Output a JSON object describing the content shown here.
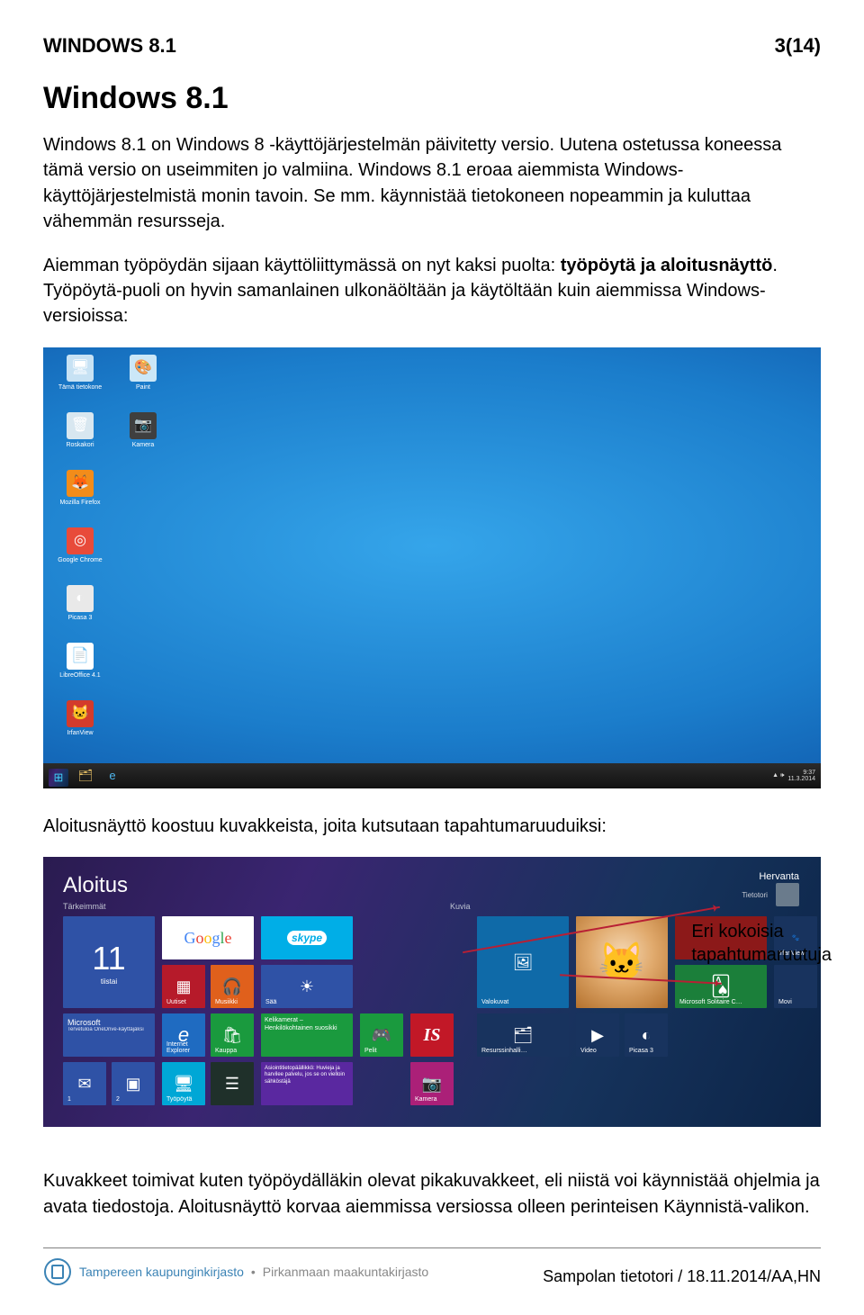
{
  "header": {
    "left": "WINDOWS 8.1",
    "right": "3(14)"
  },
  "title": "Windows 8.1",
  "para1_a": "Windows 8.1 on Windows 8 -käyttöjärjestelmän päivitetty versio. Uutena ostetussa koneessa tämä versio on useimmiten jo valmiina. Windows 8.1 eroaa aiemmista Windows-käyttöjärjestelmistä monin tavoin. Se mm. käynnistää tietokoneen nopeammin ja kuluttaa vähemmän resursseja.",
  "para2_a": "Aiemman työpöydän sijaan käyttöliittymässä on nyt kaksi puolta: ",
  "para2_bold": "työpöytä ja aloitusnäyttö",
  "para2_b": ". Työpöytä-puoli on hyvin samanlainen ulkonäöltään ja käytöltään kuin aiemmissa Windows-versioissa:",
  "para3": "Aloitusnäyttö koostuu kuvakkeista, joita kutsutaan tapahtumaruuduiksi:",
  "annotation": "Eri kokoisia\ntapahtumaruutuja",
  "para4": "Kuvakkeet toimivat kuten työpöydälläkin olevat pikakuvakkeet, eli niistä voi käynistää ohjelmia ja avata tiedostoja. Aloitusnäyttö korvaa aiemmissa versiossa olleen perinteisen Käynnistä-valikon.",
  "para4_fix": "Kuvakkeet toimivat kuten työpöydälläkin olevat pikakuvakkeet, eli niistä voi käynnistää ohjelmia ja avata tiedostoja. Aloitusnäyttö korvaa aiemmissa versiossa olleen perinteisen Käynnistä-valikon.",
  "desktop_icons": [
    {
      "label": "Tämä tietokone",
      "glyph": "🖥",
      "bg": "#c7e2f4"
    },
    {
      "label": "Paint",
      "glyph": "🎨",
      "bg": "#cbe7f7"
    },
    {
      "label": "Roskakori",
      "glyph": "🗑",
      "bg": "#d8e7f0"
    },
    {
      "label": "Kamera",
      "glyph": "📷",
      "bg": "#3f3f3f"
    },
    {
      "label": "Mozilla Firefox",
      "glyph": "🦊",
      "bg": "#f28c1a"
    },
    {
      "label": "",
      "glyph": "",
      "bg": "transparent"
    },
    {
      "label": "Google Chrome",
      "glyph": "◎",
      "bg": "#e84b3a"
    },
    {
      "label": "",
      "glyph": "",
      "bg": "transparent"
    },
    {
      "label": "Picasa 3",
      "glyph": "◐",
      "bg": "#e9e9e9"
    },
    {
      "label": "",
      "glyph": "",
      "bg": "transparent"
    },
    {
      "label": "LibreOffice 4.1",
      "glyph": "📄",
      "bg": "#ffffff"
    },
    {
      "label": "",
      "glyph": "",
      "bg": "transparent"
    },
    {
      "label": "IrfanView",
      "glyph": "🐱",
      "bg": "#d33b2c"
    }
  ],
  "taskbar": {
    "items": [
      "start",
      "file",
      "ie"
    ],
    "time": "9:37",
    "date": "11.3.2014"
  },
  "start_screen": {
    "title": "Aloitus",
    "section1": "Tärkeimmät",
    "section2": "Kuvia",
    "user": {
      "name": "Hervanta",
      "sub": "Tietotori"
    }
  },
  "tiles": {
    "big11": "11",
    "big11_sub": "tiistai",
    "microsoft": "Microsoft",
    "microsoft_sub": "Tervetuloa OneDrive-käyttäjäksi",
    "uutiset": "Uutiset",
    "musiikki": "Musiikki",
    "saa": "Sää",
    "ie": "Internet Explorer",
    "kauppa": "Kauppa",
    "keli": "Kelikamerat – Henkilökohtainen suosikki",
    "pelit": "Pelit",
    "tyopoyta": "Työpöytä",
    "asio": "Asiointitietopäällikkö: Huvieja ja harvilee palvelu, jos se on vielloin sähköstäjä",
    "kamera": "Kamera",
    "valokuvat": "Valokuvat",
    "resurssi": "Resurssinhalli…",
    "video": "Video",
    "solitaire": "Microsoft Solitaire C…",
    "picasa": "Picasa 3",
    "irfan": "IrfanView",
    "movi": "Movi"
  },
  "footer": {
    "brand_a": "Tampereen kaupunginkirjasto",
    "brand_b": "Pirkanmaan maakuntakirjasto",
    "right": "Sampolan tietotori / 18.11.2014/AA,HN"
  }
}
